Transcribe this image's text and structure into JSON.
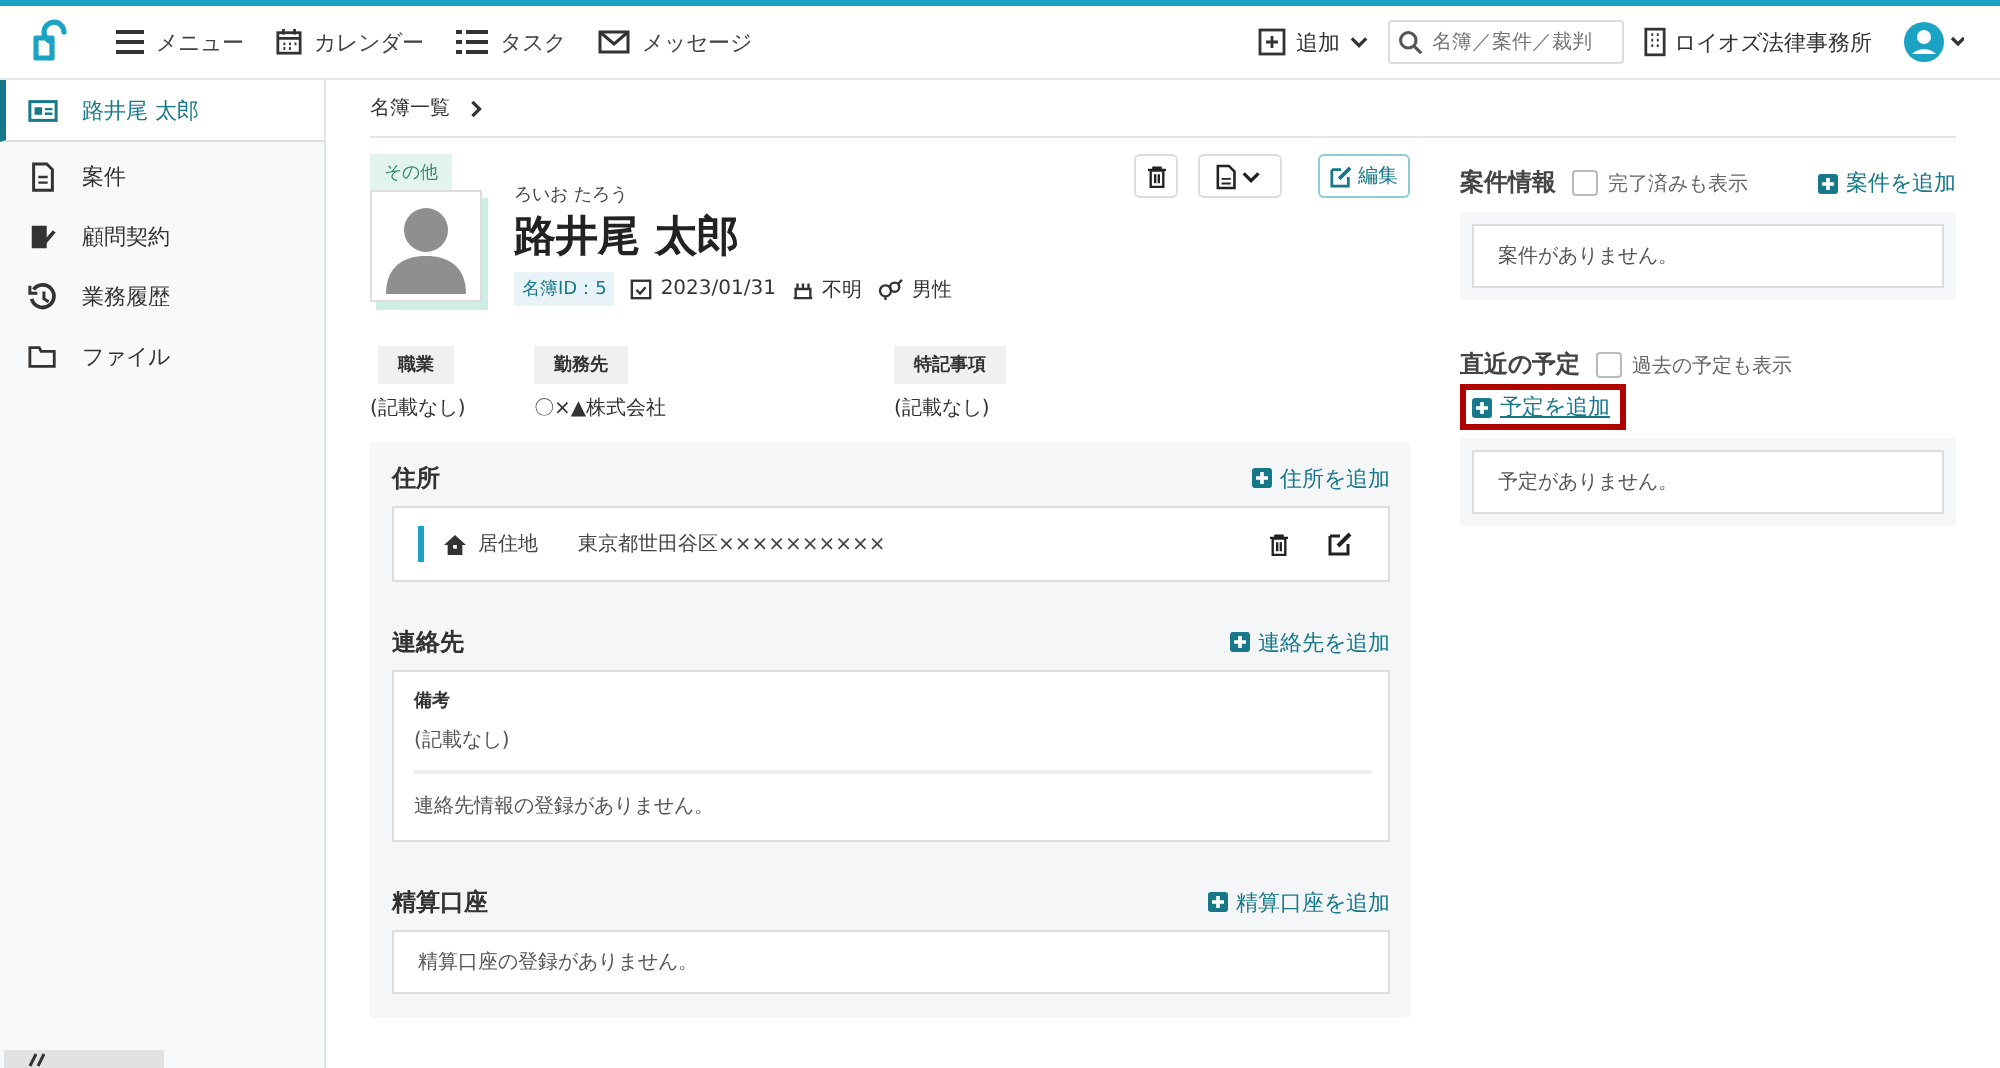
{
  "nav": [
    {
      "kind": "menu",
      "label": "メニュー"
    },
    {
      "kind": "calendar",
      "label": "カレンダー"
    },
    {
      "kind": "list",
      "label": "タスク"
    },
    {
      "kind": "mail",
      "label": "メッセージ"
    }
  ],
  "top_right": {
    "add": "追加",
    "search": {
      "placeholder": "名簿／案件／裁判"
    },
    "office": "ロイオズ法律事務所"
  },
  "sidebar": {
    "items": [
      {
        "kind": "card",
        "label": "路井尾 太郎",
        "selected": true
      },
      {
        "kind": "doc",
        "label": "案件",
        "selected": false
      },
      {
        "kind": "sign",
        "label": "顧問契約",
        "selected": false
      },
      {
        "kind": "history",
        "label": "業務履歴",
        "selected": false
      },
      {
        "kind": "folder",
        "label": "ファイル",
        "selected": false
      }
    ]
  },
  "breadcrumb": "名簿一覧",
  "profile": {
    "tag": "その他",
    "kana": "ろいお たろう",
    "name": "路井尾 太郎",
    "id_badge": "名簿ID：5",
    "date": "2023/01/31",
    "age": "不明",
    "gender": "男性",
    "edit": "編集"
  },
  "fields": [
    {
      "label": "職業",
      "value": "(記載なし)"
    },
    {
      "label": "勤務先",
      "value": "〇×▲株式会社"
    },
    {
      "label": "特記事項",
      "value": "(記載なし)"
    }
  ],
  "address": {
    "title": "住所",
    "add": "住所を追加",
    "rows": [
      {
        "type": "居住地",
        "value": "東京都世田谷区××××××××××"
      }
    ]
  },
  "contact": {
    "title": "連絡先",
    "add": "連絡先を追加",
    "note_label": "備考",
    "note": "(記載なし)",
    "empty": "連絡先情報の登録がありません。"
  },
  "account": {
    "title": "精算口座",
    "add": "精算口座を追加",
    "empty": "精算口座の登録がありません。"
  },
  "cases": {
    "title": "案件情報",
    "toggle": {
      "label": "完了済みも表示",
      "checked": false
    },
    "add": "案件を追加",
    "empty": "案件がありません。"
  },
  "schedule": {
    "title": "直近の予定",
    "toggle": {
      "label": "過去の予定も表示",
      "checked": false
    },
    "add": "予定を追加",
    "highlighted": true,
    "empty": "予定がありません。"
  }
}
